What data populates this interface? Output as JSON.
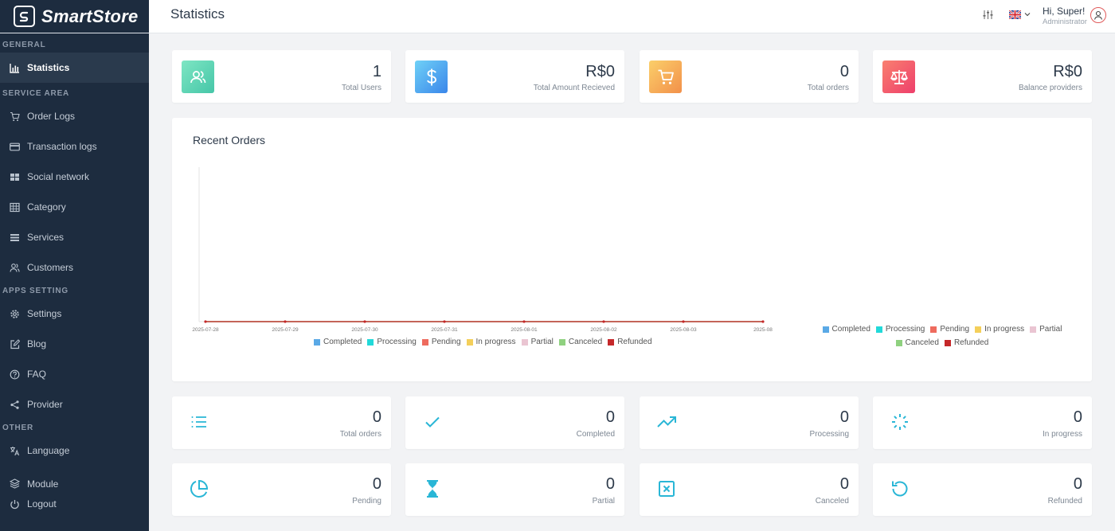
{
  "brand": {
    "name": "SmartStore"
  },
  "sidebar": {
    "sections": [
      "GENERAL",
      "SERVICE AREA",
      "APPS SETTING",
      "OTHER"
    ],
    "items": [
      {
        "label": "Statistics",
        "icon": "bar-chart-icon"
      },
      {
        "label": "Order Logs",
        "icon": "cart-icon"
      },
      {
        "label": "Transaction logs",
        "icon": "card-icon"
      },
      {
        "label": "Social network",
        "icon": "grid-icon"
      },
      {
        "label": "Category",
        "icon": "table-icon"
      },
      {
        "label": "Services",
        "icon": "list-icon"
      },
      {
        "label": "Customers",
        "icon": "users-icon"
      },
      {
        "label": "Settings",
        "icon": "gear-icon"
      },
      {
        "label": "Blog",
        "icon": "edit-icon"
      },
      {
        "label": "FAQ",
        "icon": "help-icon"
      },
      {
        "label": "Provider",
        "icon": "share-icon"
      },
      {
        "label": "Language",
        "icon": "translate-icon"
      },
      {
        "label": "Module",
        "icon": "layers-icon"
      },
      {
        "label": "Logout",
        "icon": "power-icon"
      }
    ]
  },
  "header": {
    "title": "Statistics",
    "greeting": "Hi, Super!",
    "role": "Administrator"
  },
  "stats": [
    {
      "value": "1",
      "label": "Total Users",
      "icon": "users-icon",
      "color": "#5fd4b4"
    },
    {
      "value": "R$0",
      "label": "Total Amount Recieved",
      "icon": "dollar-icon",
      "color": "#4aa8f0"
    },
    {
      "value": "0",
      "label": "Total orders",
      "icon": "cart-icon",
      "color": "#f6b256"
    },
    {
      "value": "R$0",
      "label": "Balance providers",
      "icon": "scale-icon",
      "color": "#f2566d"
    }
  ],
  "chart_data": {
    "type": "line",
    "title": "Recent Orders",
    "x": [
      "2025-07-28",
      "2025-07-29",
      "2025-07-30",
      "2025-07-31",
      "2025-08-01",
      "2025-08-02",
      "2025-08-03",
      "2025-08"
    ],
    "series": [
      {
        "name": "Completed",
        "color": "#5aa9e6",
        "values": [
          0,
          0,
          0,
          0,
          0,
          0,
          0,
          0
        ]
      },
      {
        "name": "Processing",
        "color": "#22d9d9",
        "values": [
          0,
          0,
          0,
          0,
          0,
          0,
          0,
          0
        ]
      },
      {
        "name": "Pending",
        "color": "#ee6b5e",
        "values": [
          0,
          0,
          0,
          0,
          0,
          0,
          0,
          0
        ]
      },
      {
        "name": "In progress",
        "color": "#f4cf5a",
        "values": [
          0,
          0,
          0,
          0,
          0,
          0,
          0,
          0
        ]
      },
      {
        "name": "Partial",
        "color": "#eac5d2",
        "values": [
          0,
          0,
          0,
          0,
          0,
          0,
          0,
          0
        ]
      },
      {
        "name": "Canceled",
        "color": "#8fd17f",
        "values": [
          0,
          0,
          0,
          0,
          0,
          0,
          0,
          0
        ]
      },
      {
        "name": "Refunded",
        "color": "#c5282a",
        "values": [
          0,
          0,
          0,
          0,
          0,
          0,
          0,
          0
        ]
      }
    ],
    "grid": false,
    "legend": "bottom"
  },
  "counts": [
    {
      "value": "0",
      "label": "Total orders",
      "icon": "list-icon"
    },
    {
      "value": "0",
      "label": "Completed",
      "icon": "check-icon"
    },
    {
      "value": "0",
      "label": "Processing",
      "icon": "trending-up-icon"
    },
    {
      "value": "0",
      "label": "In progress",
      "icon": "loader-icon"
    },
    {
      "value": "0",
      "label": "Pending",
      "icon": "pie-chart-icon"
    },
    {
      "value": "0",
      "label": "Partial",
      "icon": "hourglass-icon"
    },
    {
      "value": "0",
      "label": "Canceled",
      "icon": "x-square-icon"
    },
    {
      "value": "0",
      "label": "Refunded",
      "icon": "refresh-icon"
    }
  ]
}
